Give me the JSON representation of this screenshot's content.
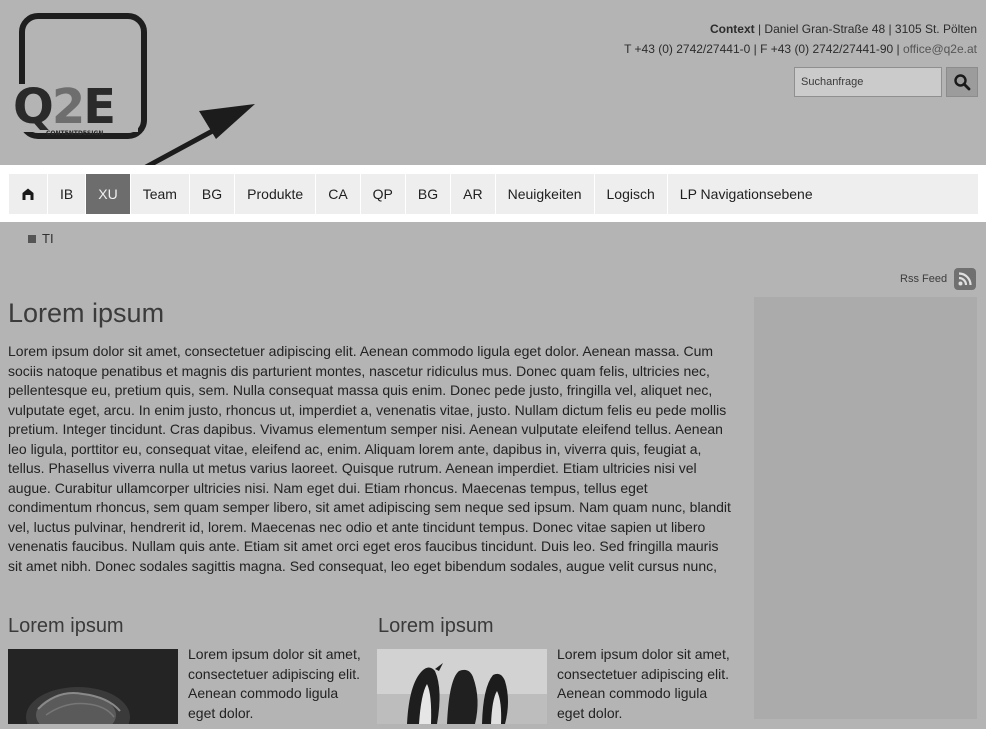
{
  "header": {
    "logo": {
      "text": "Q2E",
      "subtitle": "CONTENTDESIGN"
    },
    "contact": {
      "company": "Context",
      "address": "Daniel Gran-Straße 48 | 3105 St. Pölten",
      "phone_fax": "T +43 (0) 2742/27441-0 | F +43 (0) 2742/27441-90 |",
      "email": "office@q2e.at"
    },
    "search": {
      "placeholder": "Suchanfrage",
      "icon": "search-icon"
    }
  },
  "nav": {
    "home_icon": "home-icon",
    "items": [
      {
        "label": "IB"
      },
      {
        "label": "XU",
        "active": true
      },
      {
        "label": "Team"
      },
      {
        "label": "BG"
      },
      {
        "label": "Produkte"
      },
      {
        "label": "CA"
      },
      {
        "label": "QP"
      },
      {
        "label": "BG"
      },
      {
        "label": "AR"
      },
      {
        "label": "Neuigkeiten"
      },
      {
        "label": "Logisch"
      },
      {
        "label": "LP Navigationsebene"
      }
    ],
    "subnav": {
      "label": "TI"
    }
  },
  "rss": {
    "label": "Rss Feed",
    "icon": "rss-icon"
  },
  "main": {
    "title": "Lorem ipsum",
    "body": "Lorem ipsum dolor sit amet, consectetuer adipiscing elit. Aenean commodo ligula eget dolor. Aenean massa. Cum sociis natoque penatibus et magnis dis parturient montes, nascetur ridiculus mus. Donec quam felis, ultricies nec, pellentesque eu, pretium quis, sem. Nulla consequat massa quis enim. Donec pede justo, fringilla vel, aliquet nec, vulputate eget, arcu. In enim justo, rhoncus ut, imperdiet a, venenatis vitae, justo. Nullam dictum felis eu pede mollis pretium. Integer tincidunt. Cras dapibus. Vivamus elementum semper nisi. Aenean vulputate eleifend tellus. Aenean leo ligula, porttitor eu, consequat vitae, eleifend ac, enim. Aliquam lorem ante, dapibus in, viverra quis, feugiat a, tellus. Phasellus viverra nulla ut metus varius laoreet. Quisque rutrum. Aenean imperdiet. Etiam ultricies nisi vel augue. Curabitur ullamcorper ultricies nisi. Nam eget dui. Etiam rhoncus. Maecenas tempus, tellus eget condimentum rhoncus, sem quam semper libero, sit amet adipiscing sem neque sed ipsum. Nam quam nunc, blandit vel, luctus pulvinar, hendrerit id, lorem. Maecenas nec odio et ante tincidunt tempus. Donec vitae sapien ut libero venenatis faucibus. Nullam quis ante. Etiam sit amet orci eget eros faucibus tincidunt. Duis leo. Sed fringilla mauris sit amet nibh. Donec sodales sagittis magna. Sed consequat, leo eget bibendum sodales, augue velit cursus nunc,",
    "columns": [
      {
        "title": "Lorem ipsum",
        "text": "Lorem ipsum dolor sit amet, consectetuer adipiscing elit. Aenean commodo ligula eget dolor.",
        "image": "jellyfish"
      },
      {
        "title": "Lorem ipsum",
        "text": "Lorem ipsum dolor sit amet, consectetuer adipiscing elit. Aenean commodo ligula eget dolor.",
        "image": "penguins"
      }
    ]
  }
}
